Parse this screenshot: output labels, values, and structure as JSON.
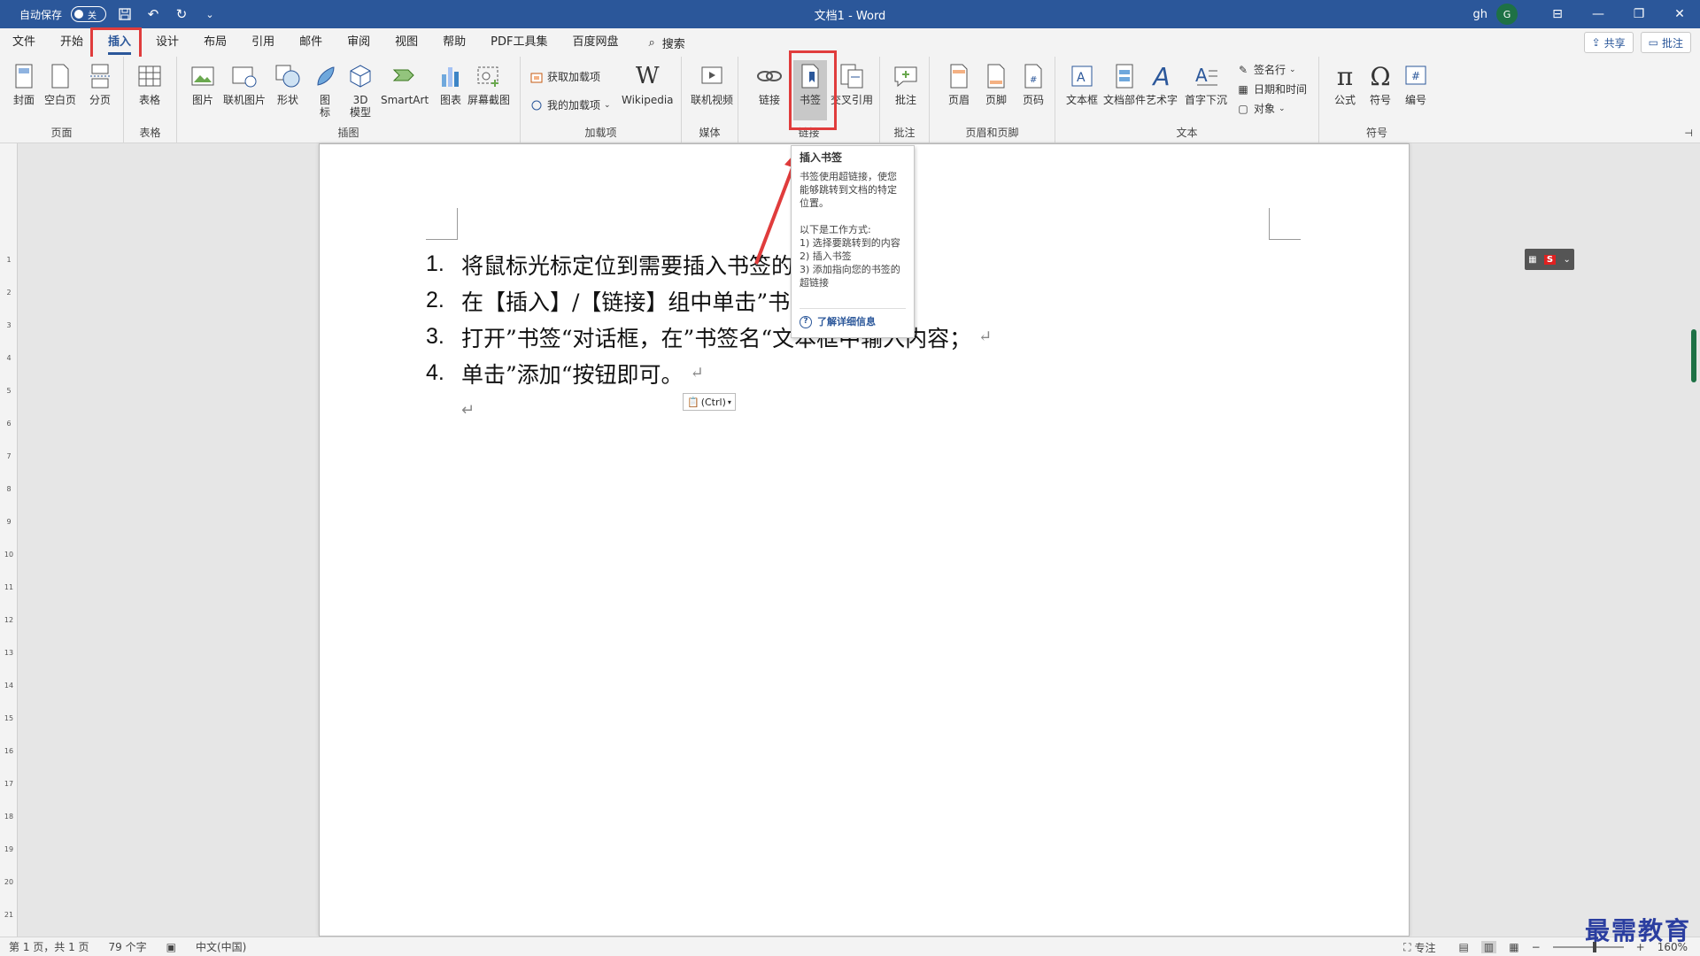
{
  "titlebar": {
    "autosave_label": "自动保存",
    "autosave_state": "关",
    "title": "文档1 - Word",
    "user": "gh",
    "avatar": "G"
  },
  "menu": {
    "tabs": [
      "文件",
      "开始",
      "插入",
      "设计",
      "布局",
      "引用",
      "邮件",
      "审阅",
      "视图",
      "帮助",
      "PDF工具集",
      "百度网盘"
    ],
    "active_tab": "插入",
    "search": "搜索",
    "share": "共享",
    "comment": "批注"
  },
  "ribbon": {
    "page": {
      "label": "页面",
      "cover": "封面",
      "blank": "空白页",
      "break": "分页"
    },
    "table": {
      "label": "表格",
      "table": "表格"
    },
    "illustrations": {
      "label": "插图",
      "picture": "图片",
      "online_picture": "联机图片",
      "shapes": "形状",
      "icons": "图标",
      "model": "3D模型",
      "smartart": "SmartArt",
      "chart": "图表",
      "screenshot": "屏幕截图"
    },
    "addins": {
      "label": "加载项",
      "get": "获取加载项",
      "mine": "我的加载项",
      "wikipedia": "Wikipedia"
    },
    "media": {
      "label": "媒体",
      "video": "联机视频"
    },
    "links": {
      "label": "链接",
      "link": "链接",
      "bookmark": "书签",
      "crossref": "交叉引用"
    },
    "comments": {
      "label": "批注",
      "comment": "批注"
    },
    "headerfooter": {
      "label": "页眉和页脚",
      "header": "页眉",
      "footer": "页脚",
      "pagenum": "页码"
    },
    "text": {
      "label": "文本",
      "textbox": "文本框",
      "parts": "文档部件",
      "wordart": "艺术字",
      "dropcap": "首字下沉",
      "signature": "签名行",
      "datetime": "日期和时间",
      "object": "对象"
    },
    "symbols": {
      "label": "符号",
      "equation": "公式",
      "symbol": "符号",
      "number": "编号"
    }
  },
  "tooltip": {
    "title": "插入书签",
    "desc": "书签使用超链接，使您能够跳转到文档的特定位置。",
    "how": "以下是工作方式:",
    "step1": "1) 选择要跳转到的内容",
    "step2": "2) 插入书签",
    "step3": "3) 添加指向您的书签的超链接",
    "more": "了解详细信息"
  },
  "document": {
    "items": [
      {
        "num": "1.",
        "text": "将鼠标光标定位到需要插入书签的"
      },
      {
        "num": "2.",
        "text": "在【插入】/【链接】组中单击”书"
      },
      {
        "num": "3.",
        "text": "打开”书签“对话框，在”书签名“文本框中输入内容；"
      },
      {
        "num": "4.",
        "text": "单击”添加“按钮即可。"
      }
    ],
    "paste_label": "(Ctrl)"
  },
  "statusbar": {
    "page": "第 1 页，共 1 页",
    "words": "79 个字",
    "language": "中文(中国)",
    "focus": "专注",
    "zoom_percent": "160%",
    "zoom_level": 0.6
  },
  "colors": {
    "accent": "#2b579a",
    "highlight_red": "#e03c3c"
  },
  "watermark": "最需教育"
}
